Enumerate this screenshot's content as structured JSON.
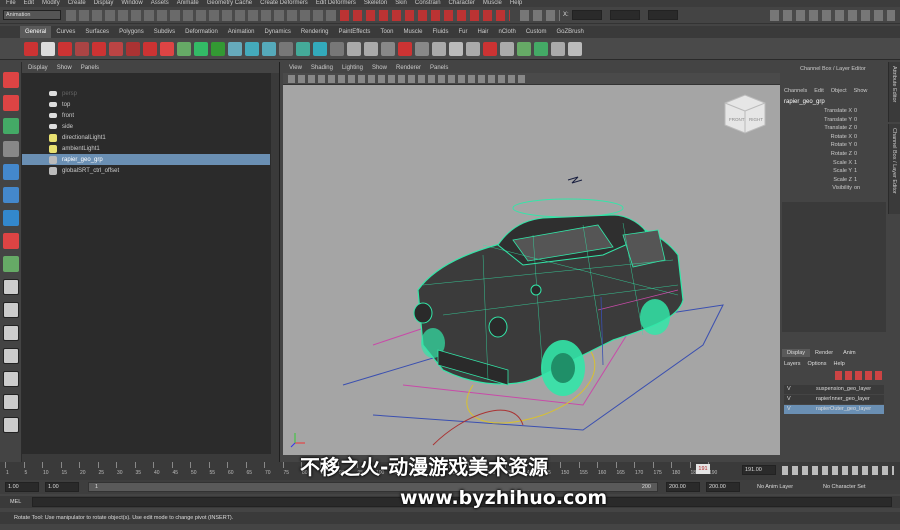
{
  "menubar": [
    "File",
    "Edit",
    "Modify",
    "Create",
    "Display",
    "Window",
    "Assets",
    "Animate",
    "Geometry Cache",
    "Create Deformers",
    "Edit Deformers",
    "Skeleton",
    "Skin",
    "Constrain",
    "Character",
    "Muscle",
    "Help"
  ],
  "status": {
    "mode": "Animation",
    "x": "X:"
  },
  "shelf_tabs": [
    {
      "label": "General",
      "active": true
    },
    {
      "label": "Curves"
    },
    {
      "label": "Surfaces"
    },
    {
      "label": "Polygons"
    },
    {
      "label": "Subdivs"
    },
    {
      "label": "Deformation"
    },
    {
      "label": "Animation"
    },
    {
      "label": "Dynamics"
    },
    {
      "label": "Rendering"
    },
    {
      "label": "PaintEffects"
    },
    {
      "label": "Toon"
    },
    {
      "label": "Muscle"
    },
    {
      "label": "Fluids"
    },
    {
      "label": "Fur"
    },
    {
      "label": "Hair"
    },
    {
      "label": "nCloth"
    },
    {
      "label": "Custom"
    },
    {
      "label": "GoZBrush"
    }
  ],
  "outliner": {
    "menu": [
      "Display",
      "Show",
      "Panels"
    ],
    "items": [
      {
        "label": "persp",
        "icon": "camera-icon",
        "dim": true
      },
      {
        "label": "top",
        "icon": "camera-icon"
      },
      {
        "label": "front",
        "icon": "camera-icon"
      },
      {
        "label": "side",
        "icon": "camera-icon"
      },
      {
        "label": "directionalLight1",
        "icon": "light-icon"
      },
      {
        "label": "ambientLight1",
        "icon": "light-icon"
      },
      {
        "label": "rapier_geo_grp",
        "icon": "group-icon",
        "selected": true
      },
      {
        "label": "globalSRT_ctrl_offset",
        "icon": "group-icon"
      }
    ]
  },
  "panel_menu": [
    "View",
    "Shading",
    "Lighting",
    "Show",
    "Renderer",
    "Panels"
  ],
  "viewcube": {
    "left": "FRONT",
    "right": "RIGHT"
  },
  "channelbox": {
    "title": "Channel Box / Layer Editor",
    "menu": [
      "Channels",
      "Edit",
      "Object",
      "Show"
    ],
    "object": "rapier_geo_grp",
    "channels": [
      {
        "name": "Translate X",
        "value": "0"
      },
      {
        "name": "Translate Y",
        "value": "0"
      },
      {
        "name": "Translate Z",
        "value": "0"
      },
      {
        "name": "Rotate X",
        "value": "0"
      },
      {
        "name": "Rotate Y",
        "value": "0"
      },
      {
        "name": "Rotate Z",
        "value": "0"
      },
      {
        "name": "Scale X",
        "value": "1"
      },
      {
        "name": "Scale Y",
        "value": "1"
      },
      {
        "name": "Scale Z",
        "value": "1"
      },
      {
        "name": "Visibility",
        "value": "on"
      }
    ]
  },
  "layer_editor": {
    "tabs": [
      "Display",
      "Render",
      "Anim"
    ],
    "menu": [
      "Layers",
      "Options",
      "Help"
    ],
    "layers": [
      {
        "v": "V",
        "name": "suspension_geo_layer"
      },
      {
        "v": "V",
        "name": "rapierInner_geo_layer"
      },
      {
        "v": "V",
        "name": "rapierOuter_geo_layer",
        "selected": true
      }
    ]
  },
  "side_tabs": [
    "Attribute Editor",
    "Channel Box / Layer Editor"
  ],
  "timeline": {
    "ticks": [
      "1",
      "5",
      "10",
      "15",
      "20",
      "25",
      "30",
      "35",
      "40",
      "45",
      "50",
      "55",
      "60",
      "65",
      "70",
      "75",
      "80",
      "85",
      "90",
      "95",
      "100",
      "105",
      "110",
      "115",
      "120",
      "125",
      "130",
      "135",
      "140",
      "145",
      "150",
      "155",
      "160",
      "165",
      "170",
      "175",
      "180",
      "185",
      "190"
    ],
    "current": "191",
    "current_field": "191.00"
  },
  "range": {
    "start": "1.00",
    "inner_start": "1.00",
    "inner_marker": "1",
    "range_end": "200",
    "end": "200.00",
    "end2": "200.00",
    "anim_layer": "No Anim Layer",
    "char_set": "No Character Set"
  },
  "cmd": {
    "label": "MEL"
  },
  "help": {
    "text": "Rotate Tool: Use manipulator to rotate object(s). Use edit mode to change pivot (INSERT)."
  },
  "watermark": {
    "line1": "不移之火-动漫游戏美术资源",
    "line2": "www.byzhihuo.com"
  },
  "colors": {
    "accent": "#6a8fb3",
    "wire": "#33e6a8",
    "viewport_bg": "#a5a5a5"
  }
}
